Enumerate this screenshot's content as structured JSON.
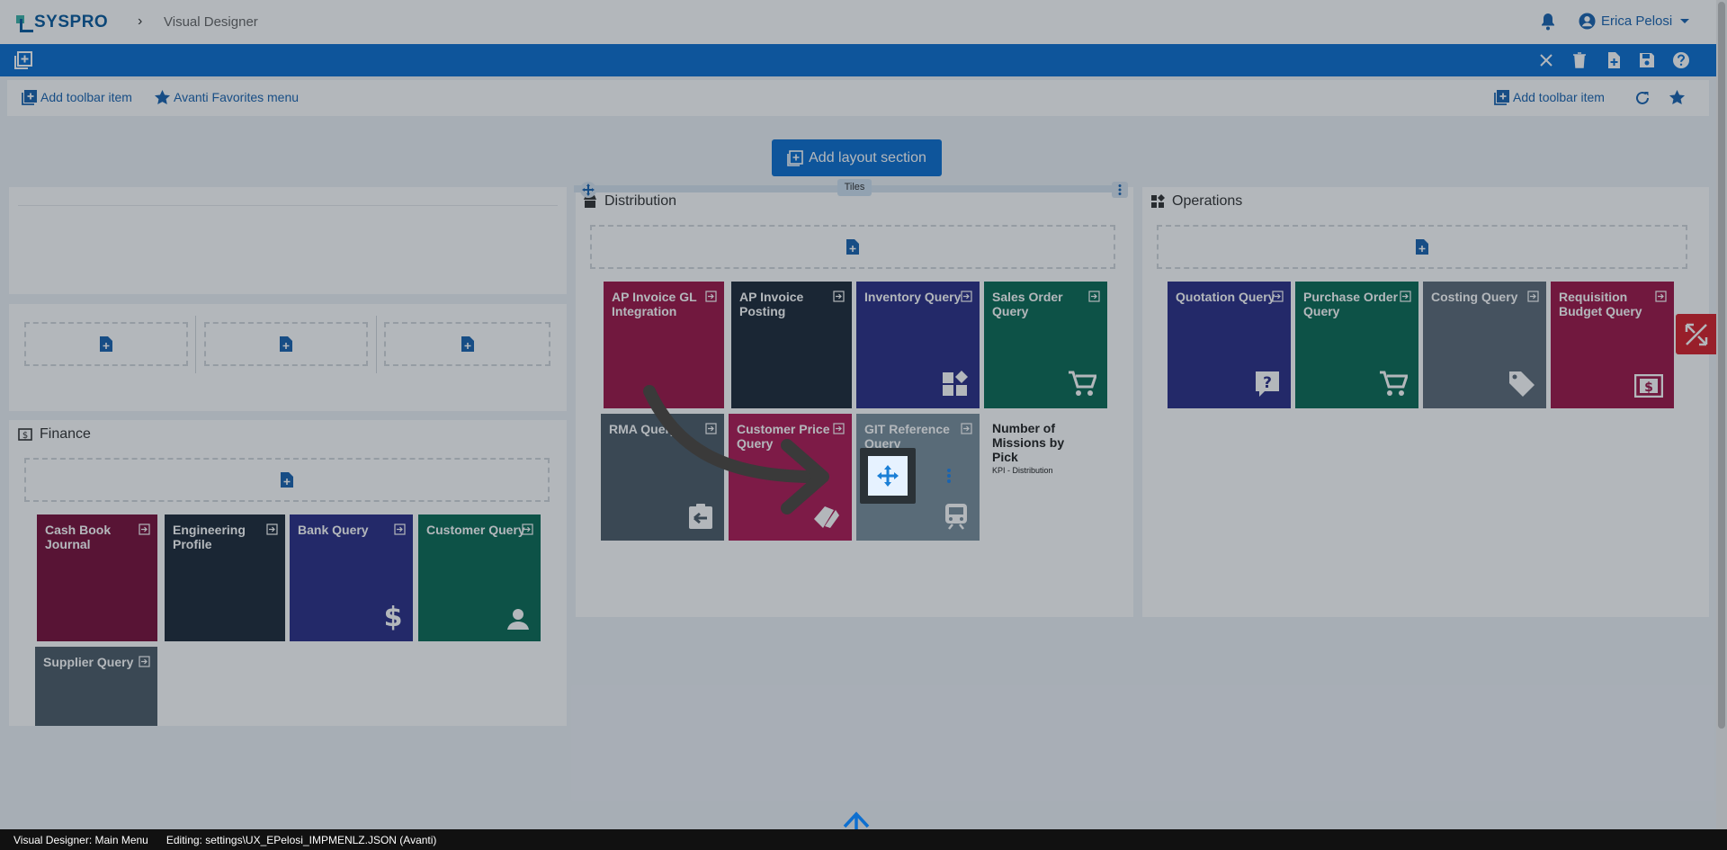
{
  "header": {
    "logo_text": "SYSPRO",
    "breadcrumb_separator": "›",
    "breadcrumb_current": "Visual Designer",
    "user_name": "Erica Pelosi"
  },
  "subtoolbar": {
    "left_add_label": "Add toolbar item",
    "favorites_label": "Avanti Favorites menu",
    "right_add_label": "Add toolbar item"
  },
  "add_layout_section_label": "Add layout section",
  "tiles_chip_label": "Tiles",
  "panels": {
    "finance_title": "Finance",
    "distribution_title": "Distribution",
    "operations_title": "Operations"
  },
  "finance_tiles": [
    {
      "label": "Cash Book Journal",
      "color": "#7a0f3a"
    },
    {
      "label": "Engineering Profile",
      "color": "#1e2a38"
    },
    {
      "label": "Bank Query",
      "color": "#2c2e86"
    },
    {
      "label": "Customer Query",
      "color": "#0b6a55"
    },
    {
      "label": "Supplier Query",
      "color": "#4d5c68"
    }
  ],
  "distribution_tiles": [
    {
      "label": "AP Invoice GL Integration",
      "color": "#9e1648"
    },
    {
      "label": "AP Invoice Posting",
      "color": "#1e2a38"
    },
    {
      "label": "Inventory Query",
      "color": "#2c2e86"
    },
    {
      "label": "Sales Order Query",
      "color": "#0b6a55"
    },
    {
      "label": "RMA Query",
      "color": "#4d5c68"
    },
    {
      "label": "Customer Price Query",
      "color": "#b01a55"
    },
    {
      "label": "GIT Reference Query",
      "color": "#7b8f9d"
    }
  ],
  "kpi": {
    "title": "Number of Missions by Pick",
    "subtitle": "KPI - Distribution"
  },
  "operations_tiles": [
    {
      "label": "Quotation Query",
      "color": "#2c2e86"
    },
    {
      "label": "Purchase Order Query",
      "color": "#0b6a55"
    },
    {
      "label": "Costing Query",
      "color": "#5d6b78"
    },
    {
      "label": "Requisition Budget Query",
      "color": "#9e1648"
    }
  ],
  "status_bar": {
    "left": "Visual Designer: Main Menu",
    "editing": "Editing: settings\\UX_EPelosi_IMPMENLZ.JSON  (Avanti)"
  }
}
